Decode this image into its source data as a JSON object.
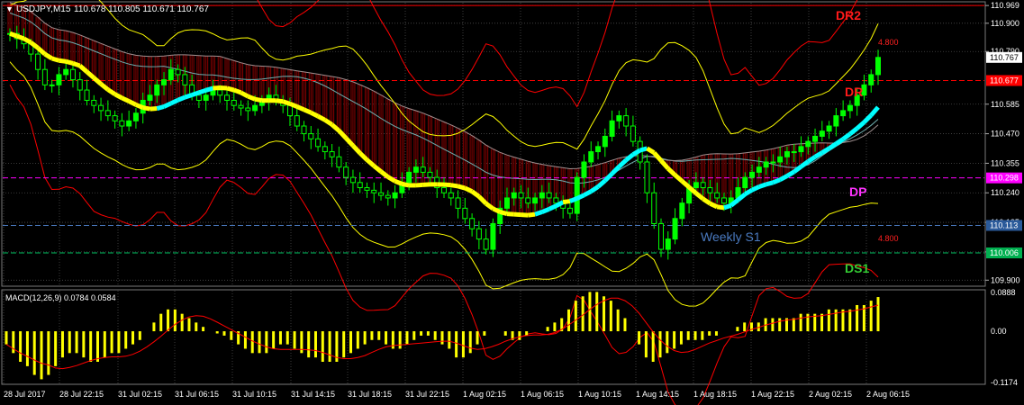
{
  "window": {
    "symbol_header": "USDJPY,M15",
    "ohlc_header": "110.678 110.805 110.671 110.767"
  },
  "price_axis": {
    "ticks": [
      "110.969",
      "110.900",
      "110.790",
      "110.585",
      "110.470",
      "110.355",
      "110.240",
      "110.125",
      "110.010",
      "109.900"
    ],
    "ticks_values": [
      110.969,
      110.9,
      110.79,
      110.585,
      110.47,
      110.355,
      110.24,
      110.125,
      110.01,
      109.9
    ],
    "badges": [
      {
        "label": "110.767",
        "value": 110.767,
        "color": "#ffffff",
        "text_color": "#000000"
      },
      {
        "label": "110.677",
        "value": 110.677,
        "color": "#ff0000",
        "text_color": "#ffffff"
      },
      {
        "label": "110.298",
        "value": 110.298,
        "color": "#ff00ff",
        "text_color": "#ffffff"
      },
      {
        "label": "110.113",
        "value": 110.113,
        "color": "#2a5a9a",
        "text_color": "#ffffff"
      },
      {
        "label": "110.006",
        "value": 110.006,
        "color": "#00b050",
        "text_color": "#ffffff"
      }
    ]
  },
  "levels": [
    {
      "name": "DR2",
      "label": "DR2",
      "value": 110.969,
      "color": "#ff0000",
      "style": "solid"
    },
    {
      "name": "DR",
      "label": "DR",
      "value": 110.677,
      "color": "#ff0000",
      "style": "dashed"
    },
    {
      "name": "DP",
      "label": "DP",
      "value": 110.298,
      "color": "#ff00ff",
      "style": "dashed"
    },
    {
      "name": "Weekly S1",
      "label": "Weekly S1",
      "value": 110.113,
      "color": "#4a7ac0",
      "style": "dashed"
    },
    {
      "name": "DS1",
      "label": "DS1",
      "value": 110.006,
      "color": "#00c060",
      "style": "dashed"
    }
  ],
  "bb_labels": {
    "upper": "4.800",
    "lower": "4.800"
  },
  "macd": {
    "header": "MACD(12,26,9) 0.0784 0.0584",
    "ticks": [
      "0.0888",
      "0.00",
      "-0.1174"
    ],
    "ticks_values": [
      0.0888,
      0.0,
      -0.1174
    ]
  },
  "time_axis": {
    "labels": [
      "28 Jul 2017",
      "28 Jul 22:15",
      "31 Jul 02:15",
      "31 Jul 06:15",
      "31 Jul 10:15",
      "31 Jul 14:15",
      "31 Jul 18:15",
      "31 Jul 22:15",
      "1 Aug 02:15",
      "1 Aug 06:15",
      "1 Aug 10:15",
      "1 Aug 14:15",
      "1 Aug 18:15",
      "1 Aug 22:15",
      "2 Aug 02:15",
      "2 Aug 06:15"
    ]
  },
  "colors": {
    "background": "#000000",
    "candles": "#00ff00",
    "ma_fast": "#ffff00",
    "ma_cyan": "#00ffff",
    "cloud": "#8b0000",
    "bands_inner": "#ffff00",
    "bands_outer": "#ff0000",
    "macd_hist": "#ffff00",
    "macd_signal": "#ff0000",
    "grid": "#4a4a4a"
  },
  "chart_data": {
    "type": "line",
    "symbol": "USDJPY",
    "timeframe": "M15",
    "ylim": [
      109.88,
      110.98
    ],
    "approx_close_series": [
      110.86,
      110.84,
      110.82,
      110.78,
      110.72,
      110.66,
      110.66,
      110.7,
      110.72,
      110.68,
      110.64,
      110.6,
      110.58,
      110.56,
      110.54,
      110.52,
      110.5,
      110.52,
      110.55,
      110.6,
      110.62,
      110.66,
      110.68,
      110.72,
      110.7,
      110.66,
      110.62,
      110.6,
      110.62,
      110.64,
      110.62,
      110.6,
      110.58,
      110.57,
      110.56,
      110.58,
      110.6,
      110.62,
      110.6,
      110.58,
      110.54,
      110.5,
      110.47,
      110.45,
      110.42,
      110.4,
      110.38,
      110.34,
      110.3,
      110.28,
      110.26,
      110.25,
      110.24,
      110.23,
      110.22,
      110.24,
      110.28,
      110.32,
      110.34,
      110.32,
      110.3,
      110.26,
      110.24,
      110.22,
      110.18,
      110.14,
      110.1,
      110.06,
      110.02,
      110.12,
      110.18,
      110.22,
      110.24,
      110.22,
      110.2,
      110.22,
      110.24,
      110.22,
      110.2,
      110.18,
      110.16,
      110.3,
      110.36,
      110.4,
      110.42,
      110.46,
      110.52,
      110.54,
      110.5,
      110.44,
      110.36,
      110.24,
      110.12,
      110.02,
      110.06,
      110.14,
      110.2,
      110.26,
      110.28,
      110.26,
      110.24,
      110.22,
      110.2,
      110.22,
      110.26,
      110.3,
      110.32,
      110.34,
      110.36,
      110.36,
      110.38,
      110.4,
      110.4,
      110.42,
      110.44,
      110.46,
      110.48,
      110.5,
      110.54,
      110.56,
      110.58,
      110.62,
      110.66,
      110.7,
      110.767
    ],
    "macd_hist_series": [
      -0.03,
      -0.05,
      -0.07,
      -0.08,
      -0.1,
      -0.11,
      -0.1,
      -0.08,
      -0.06,
      -0.05,
      -0.05,
      -0.06,
      -0.07,
      -0.07,
      -0.06,
      -0.05,
      -0.05,
      -0.04,
      -0.03,
      -0.02,
      0.0,
      0.02,
      0.04,
      0.05,
      0.05,
      0.04,
      0.03,
      0.02,
      0.01,
      0.0,
      -0.005,
      -0.01,
      -0.02,
      -0.03,
      -0.04,
      -0.05,
      -0.05,
      -0.05,
      -0.04,
      -0.03,
      -0.03,
      -0.04,
      -0.05,
      -0.06,
      -0.06,
      -0.07,
      -0.07,
      -0.07,
      -0.06,
      -0.05,
      -0.04,
      -0.03,
      -0.02,
      -0.02,
      -0.03,
      -0.04,
      -0.04,
      -0.03,
      -0.02,
      -0.01,
      -0.01,
      -0.02,
      -0.03,
      -0.04,
      -0.06,
      -0.06,
      -0.05,
      -0.03,
      -0.01,
      0.0,
      0.0,
      -0.01,
      -0.02,
      -0.02,
      -0.01,
      0.0,
      0.0,
      0.01,
      0.02,
      0.03,
      0.05,
      0.07,
      0.08,
      0.09,
      0.09,
      0.08,
      0.07,
      0.05,
      0.03,
      0.0,
      -0.03,
      -0.06,
      -0.07,
      -0.06,
      -0.05,
      -0.04,
      -0.03,
      -0.02,
      -0.02,
      -0.02,
      -0.01,
      -0.01,
      0.0,
      0.0,
      0.01,
      0.02,
      0.02,
      0.02,
      0.03,
      0.03,
      0.03,
      0.03,
      0.03,
      0.04,
      0.04,
      0.04,
      0.04,
      0.05,
      0.05,
      0.05,
      0.05,
      0.06,
      0.06,
      0.07,
      0.0784
    ]
  }
}
